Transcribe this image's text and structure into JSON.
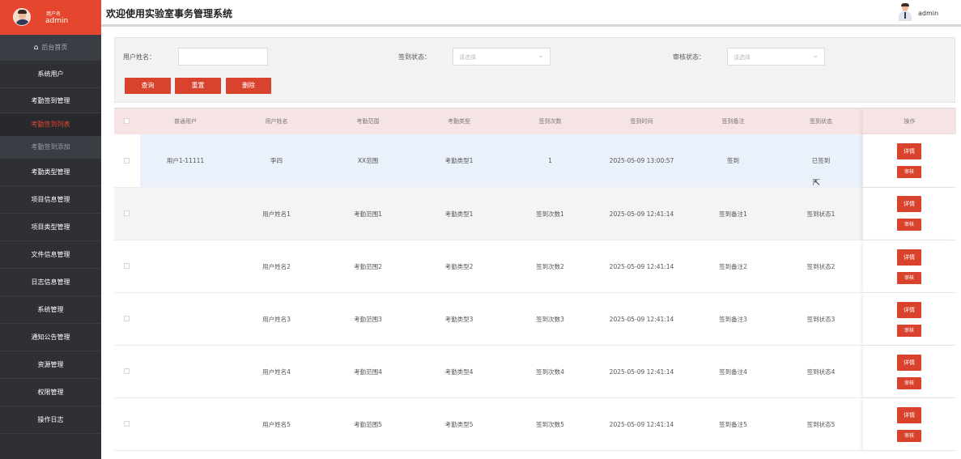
{
  "sidebar": {
    "user_label": "用户名",
    "username": "admin",
    "home": "后台首页",
    "items": [
      {
        "label": "系统用户"
      },
      {
        "label": "考勤签到管理"
      },
      {
        "label": "考勤签到列表"
      },
      {
        "label": "考勤签到添加"
      },
      {
        "label": "考勤类型管理"
      },
      {
        "label": "项目信息管理"
      },
      {
        "label": "项目类型管理"
      },
      {
        "label": "文件信息管理"
      },
      {
        "label": "日志信息管理"
      },
      {
        "label": "系统管理"
      },
      {
        "label": "通知公告管理"
      },
      {
        "label": "资源管理"
      },
      {
        "label": "权限管理"
      },
      {
        "label": "操作日志"
      }
    ]
  },
  "header": {
    "title": "欢迎使用实验室事务管理系统",
    "username": "admin"
  },
  "search": {
    "name_label": "用户姓名：",
    "name_value": "",
    "sign_status_label": "签到状态：",
    "sign_status_placeholder": "请选择",
    "review_status_label": "审核状态：",
    "review_status_placeholder": "请选择",
    "query_btn": "查询",
    "reset_btn": "重置",
    "delete_btn": "删除"
  },
  "table": {
    "columns": [
      "普通用户",
      "用户姓名",
      "考勤范围",
      "考勤类型",
      "签到次数",
      "签到时间",
      "签到备注",
      "签到状态",
      "操作"
    ],
    "rows": [
      [
        "用户1-11111",
        "李四",
        "XX范围",
        "考勤类型1",
        "1",
        "2025-05-09 13:00:57",
        "签到",
        "已签到"
      ],
      [
        "",
        "用户姓名1",
        "考勤范围1",
        "考勤类型1",
        "签到次数1",
        "2025-05-09 12:41:14",
        "签到备注1",
        "签到状态1"
      ],
      [
        "",
        "用户姓名2",
        "考勤范围2",
        "考勤类型2",
        "签到次数2",
        "2025-05-09 12:41:14",
        "签到备注2",
        "签到状态2"
      ],
      [
        "",
        "用户姓名3",
        "考勤范围3",
        "考勤类型3",
        "签到次数3",
        "2025-05-09 12:41:14",
        "签到备注3",
        "签到状态3"
      ],
      [
        "",
        "用户姓名4",
        "考勤范围4",
        "考勤类型4",
        "签到次数4",
        "2025-05-09 12:41:14",
        "签到备注4",
        "签到状态4"
      ],
      [
        "",
        "用户姓名5",
        "考勤范围5",
        "考勤类型5",
        "签到次数5",
        "2025-05-09 12:41:14",
        "签到备注5",
        "签到状态5"
      ]
    ],
    "detail_btn": "详情",
    "review_btn": "审核"
  },
  "colors": {
    "accent": "#d9432e",
    "sidebar_bg": "#2e3035",
    "header_row_bg": "#f6e4e4"
  }
}
